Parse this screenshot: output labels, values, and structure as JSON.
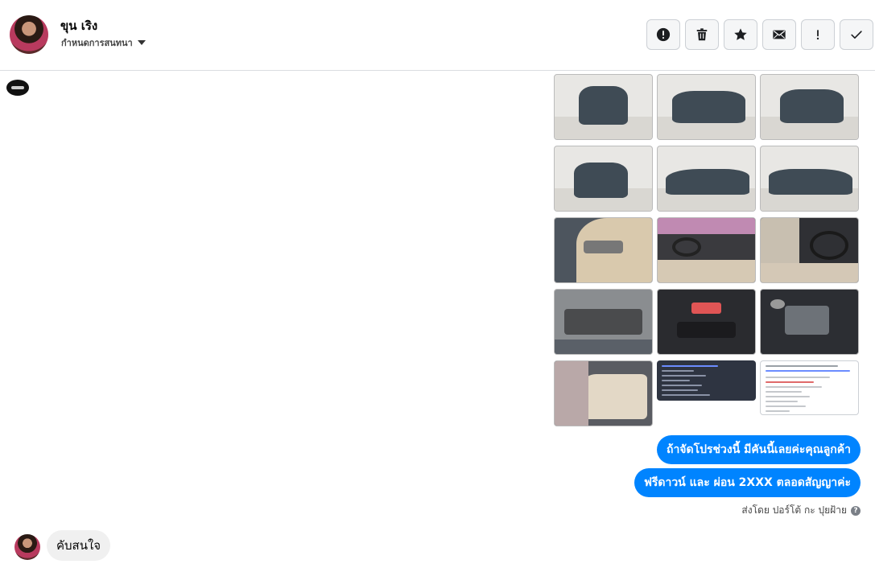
{
  "header": {
    "name": "ขุน เริง",
    "subtitle": "กำหนดการสนทนา",
    "actions": [
      {
        "name": "mark-spam-button",
        "icon": "alert-circle-icon"
      },
      {
        "name": "delete-button",
        "icon": "trash-icon"
      },
      {
        "name": "star-button",
        "icon": "star-icon"
      },
      {
        "name": "mark-unread-button",
        "icon": "envelope-icon"
      },
      {
        "name": "mark-important-button",
        "icon": "exclamation-icon"
      },
      {
        "name": "mark-done-button",
        "icon": "check-icon"
      }
    ]
  },
  "conversation": {
    "photos": [
      {
        "name": "car-photo-front",
        "icon": "car-exterior"
      },
      {
        "name": "car-photo-front-right",
        "icon": "car-exterior"
      },
      {
        "name": "car-photo-rear-left",
        "icon": "car-exterior"
      },
      {
        "name": "car-photo-rear",
        "icon": "car-exterior"
      },
      {
        "name": "car-photo-side-right",
        "icon": "car-exterior"
      },
      {
        "name": "car-photo-side-left",
        "icon": "car-exterior"
      },
      {
        "name": "car-photo-door-interior",
        "icon": "car-interior"
      },
      {
        "name": "car-photo-dashboard",
        "icon": "car-interior"
      },
      {
        "name": "car-photo-gearshift",
        "icon": "car-interior"
      },
      {
        "name": "car-photo-engine",
        "icon": "engine"
      },
      {
        "name": "car-photo-console",
        "icon": "car-interior"
      },
      {
        "name": "car-photo-engine-bay",
        "icon": "engine"
      },
      {
        "name": "car-photo-rear-seats",
        "icon": "car-interior"
      }
    ],
    "screenshots": [
      {
        "name": "spec-screenshot",
        "icon": "dark-list-screenshot"
      },
      {
        "name": "post-screenshot",
        "icon": "light-post-screenshot"
      }
    ],
    "outgoing_messages": [
      "ถ้าจัดโปรช่วงนี้ มีคันนี้เลยค่ะคุณลูกค้า",
      "ฟรีดาวน์ และ ผ่อน 2XXX ตลอดสัญญาค่ะ"
    ],
    "sent_by": "ส่งโดย ปอร์โต้ กะ ปุยฝ้าย",
    "incoming_message": "คับสนใจ"
  },
  "colors": {
    "outgoing_bubble": "#0084ff",
    "incoming_bubble": "#f0f0f0",
    "header_border": "#dadde1"
  }
}
